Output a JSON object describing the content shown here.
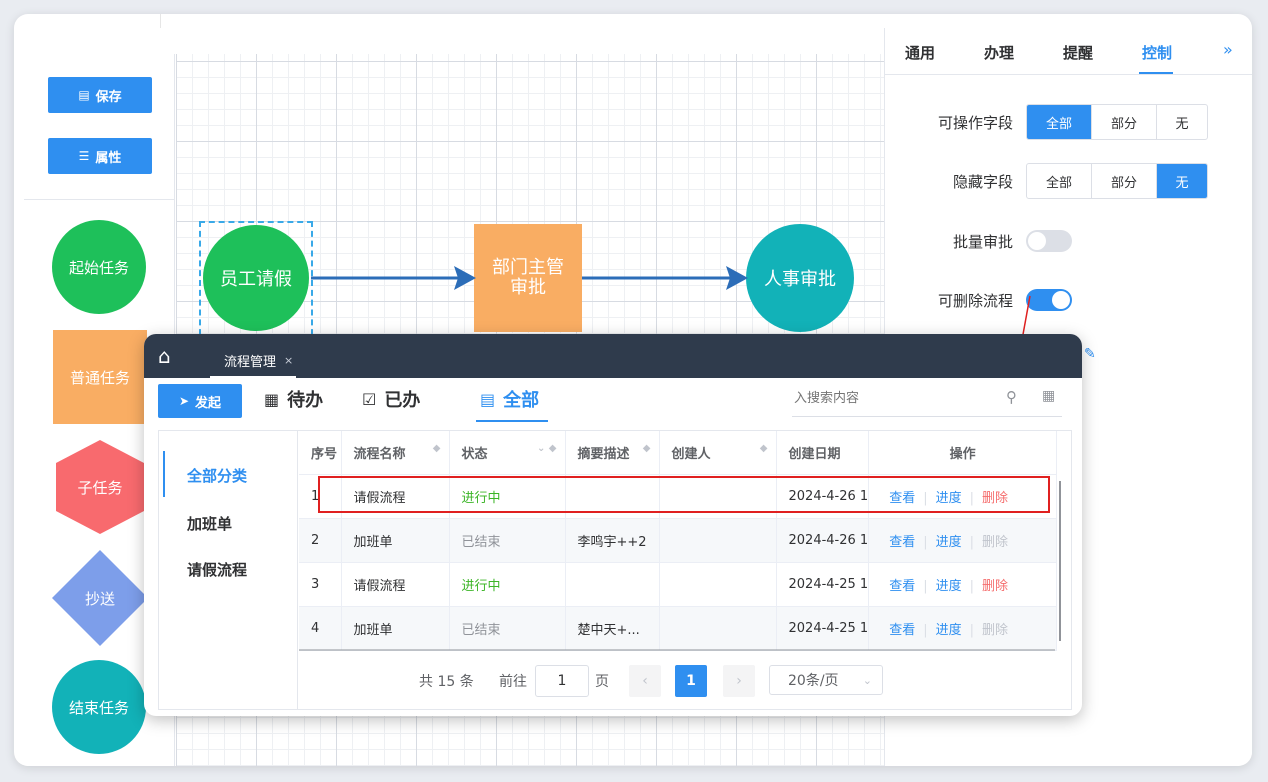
{
  "palette": {
    "save_label": "保存",
    "props_label": "属性",
    "shapes": [
      {
        "label": "起始任务",
        "color": "#1ec05a"
      },
      {
        "label": "普通任务",
        "color": "#f9ad63"
      },
      {
        "label": "子任务",
        "color": "#f86a6e"
      },
      {
        "label": "抄送",
        "color": "#7d9eea"
      },
      {
        "label": "结束任务",
        "color": "#12b2b8"
      }
    ]
  },
  "canvas": {
    "nodes": [
      {
        "label": "员工请假",
        "color": "#1ec05a"
      },
      {
        "label": "部门主管审批",
        "color": "#f9ad63"
      },
      {
        "label": "人事审批",
        "color": "#12b2b8"
      }
    ],
    "edge_color": "#2c6db8"
  },
  "right_panel": {
    "tabs": [
      "通用",
      "办理",
      "提醒",
      "控制"
    ],
    "active_tab": "控制",
    "operable_fields": {
      "label": "可操作字段",
      "options": [
        "全部",
        "部分",
        "无"
      ],
      "selected": "全部"
    },
    "hidden_fields": {
      "label": "隐藏字段",
      "options": [
        "全部",
        "部分",
        "无"
      ],
      "selected": "无"
    },
    "batch_approve": {
      "label": "批量审批",
      "on": false
    },
    "deletable": {
      "label": "可删除流程",
      "on": true
    },
    "accent": "#2f8ff0"
  },
  "dialog": {
    "tab_title": "流程管理",
    "start_button": "发起",
    "tabs": [
      {
        "label": "待办",
        "icon": "todo-list-icon"
      },
      {
        "label": "已办",
        "icon": "done-check-icon"
      },
      {
        "label": "全部",
        "icon": "list-icon"
      }
    ],
    "search_placeholder": "入搜索内容",
    "categories": [
      "全部分类",
      "加班单",
      "请假流程"
    ],
    "columns": [
      "序号",
      "流程名称",
      "状态",
      "摘要描述",
      "创建人",
      "创建日期",
      "操作"
    ],
    "rows": [
      {
        "no": "1",
        "name": "请假流程",
        "status": "进行中",
        "summary": "",
        "creator": "",
        "date": "2024-4-26 1",
        "view": "查看",
        "progress": "进度",
        "delete": "删除"
      },
      {
        "no": "2",
        "name": "加班单",
        "status": "已结束",
        "summary": "李鸣宇++2",
        "creator": "",
        "date": "2024-4-26 1",
        "view": "查看",
        "progress": "进度",
        "delete": "删除"
      },
      {
        "no": "3",
        "name": "请假流程",
        "status": "进行中",
        "summary": "",
        "creator": "",
        "date": "2024-4-25 1",
        "view": "查看",
        "progress": "进度",
        "delete": "删除"
      },
      {
        "no": "4",
        "name": "加班单",
        "status": "已结束",
        "summary": "楚中天+...",
        "creator": "",
        "date": "2024-4-25 1",
        "view": "查看",
        "progress": "进度",
        "delete": "删除"
      }
    ],
    "pager": {
      "total": "共 15 条",
      "goto": "前往",
      "page_input": "1",
      "page_unit": "页",
      "current": "1",
      "size": "20条/页"
    }
  }
}
